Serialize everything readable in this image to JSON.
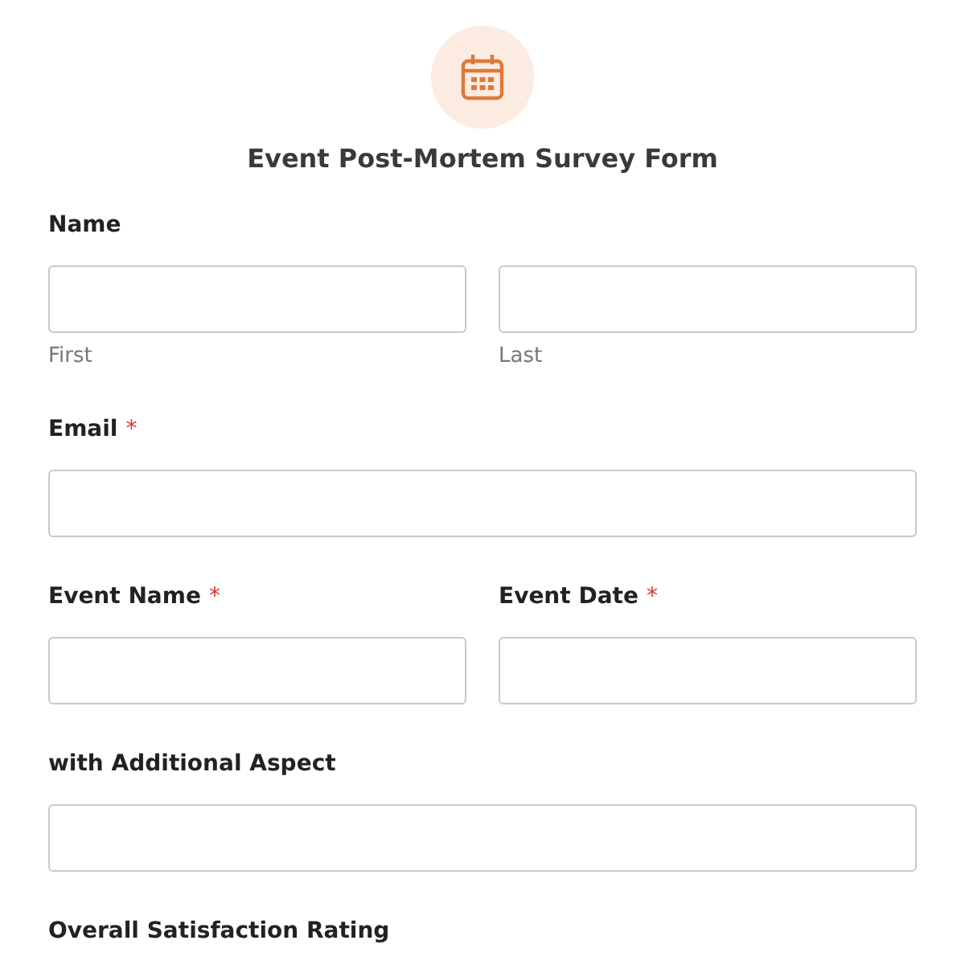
{
  "form": {
    "title": "Event Post-Mortem Survey Form"
  },
  "rows": [
    {
      "fields": [
        {
          "label": "Name",
          "kind": "name",
          "sublabels": [
            "First",
            "Last"
          ]
        }
      ]
    },
    {
      "fields": [
        {
          "label": "Email",
          "kind": "text",
          "required_mark": "*"
        }
      ]
    },
    {
      "fields": [
        {
          "label": "Event Name",
          "kind": "text",
          "required_mark": "*"
        },
        {
          "label": "Event Date",
          "kind": "text",
          "required_mark": "*"
        }
      ]
    },
    {
      "fields": [
        {
          "label": "with Additional Aspect",
          "kind": "text"
        }
      ]
    },
    {
      "fields": [
        {
          "label": "Overall Satisfaction Rating",
          "kind": "label"
        }
      ]
    }
  ]
}
